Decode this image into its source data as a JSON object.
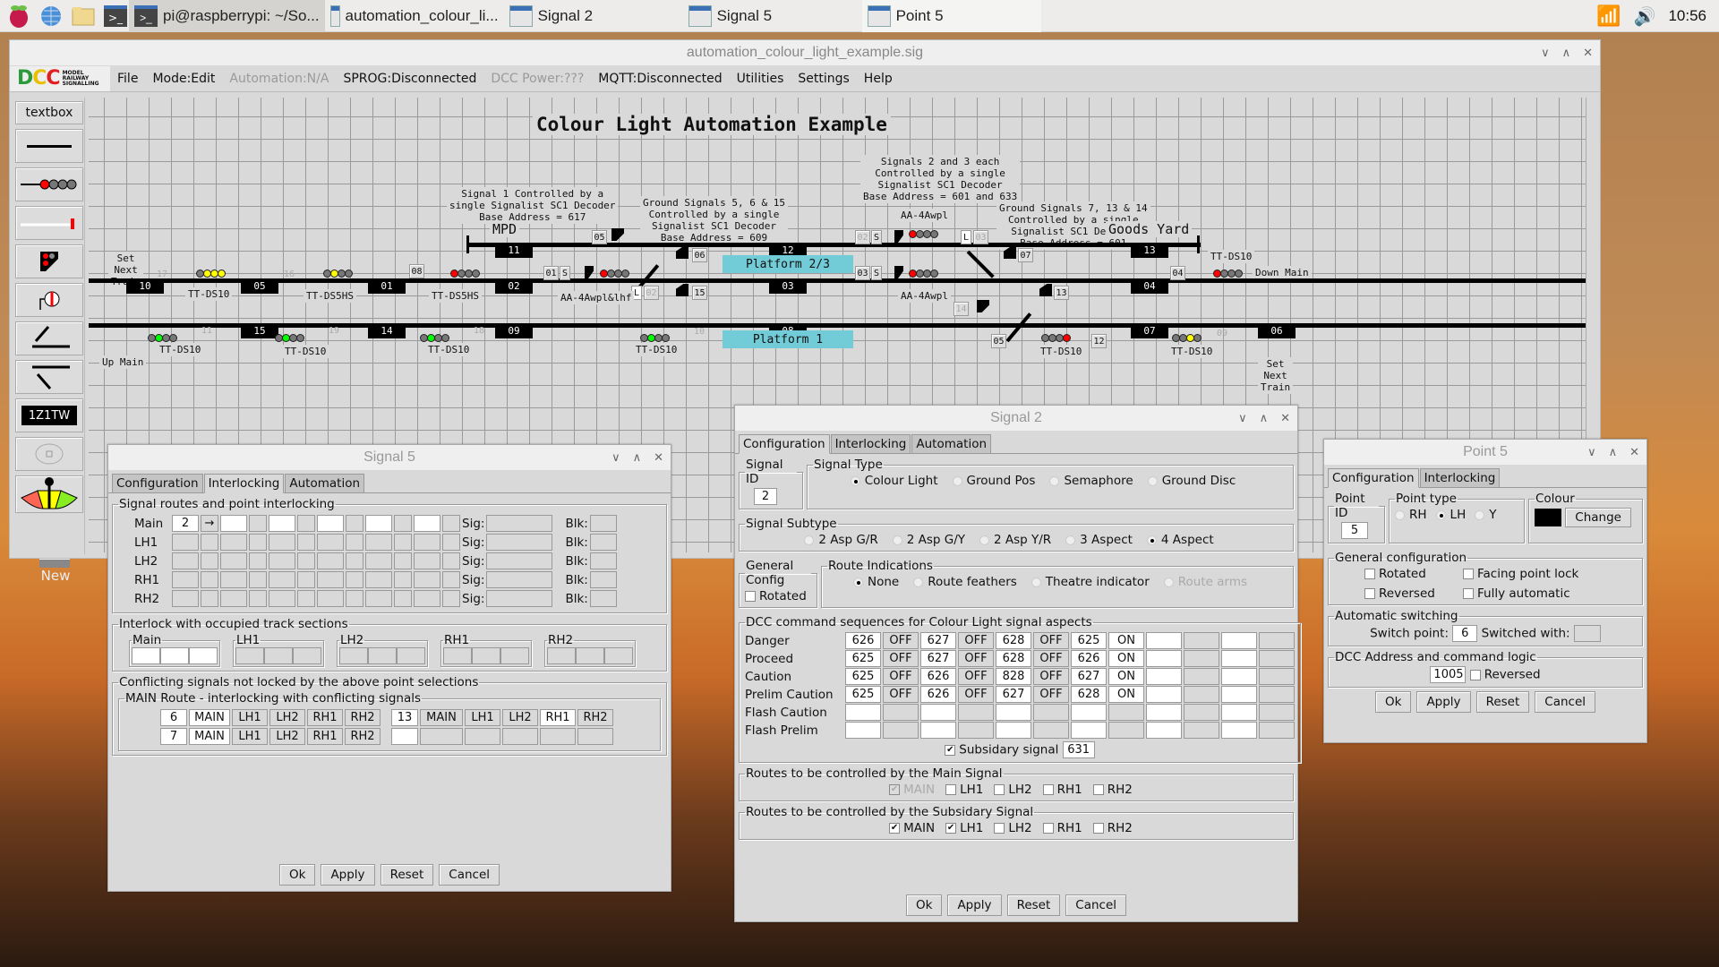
{
  "taskbar": {
    "tasks": [
      {
        "label": "pi@raspberrypi: ~/So..."
      },
      {
        "label": "automation_colour_li..."
      },
      {
        "label": "Signal 2"
      },
      {
        "label": "Signal 5"
      },
      {
        "label": "Point 5"
      }
    ],
    "clock": "10:56"
  },
  "desktop": {
    "new_icon_label": "New"
  },
  "main_window": {
    "title": "automation_colour_light_example.sig",
    "logo_text": "DCC",
    "logo_sub": "MODEL RAILWAY SIGNALLING",
    "menu": [
      {
        "label": "File",
        "enabled": true
      },
      {
        "label": "Mode:Edit",
        "enabled": true
      },
      {
        "label": "Automation:N/A",
        "enabled": false
      },
      {
        "label": "SPROG:Disconnected",
        "enabled": true
      },
      {
        "label": "DCC Power:???",
        "enabled": false
      },
      {
        "label": "MQTT:Disconnected",
        "enabled": true
      },
      {
        "label": "Utilities",
        "enabled": true
      },
      {
        "label": "Settings",
        "enabled": true
      },
      {
        "label": "Help",
        "enabled": true
      }
    ],
    "toolbox": {
      "textbox": "textbox",
      "train_label": "1Z1TW"
    }
  },
  "schematic": {
    "title": "Colour Light Automation Example",
    "mpd": "MPD",
    "goods_yard": "Goods Yard",
    "notes": {
      "sig1": "Signal 1 Controlled by a\nsingle Signalist SC1 Decoder\nBase Address = 617",
      "ground_5_6_15": "Ground Signals 5, 6 & 15\nControlled by a single\nSignalist SC1 Decoder\nBase Address = 609",
      "sig2_3": "Signals 2 and 3 each\nControlled by a single\nSignalist SC1 Decoder\nBase Address = 601 and 633",
      "ground_7_13_14": "Ground Signals 7, 13 & 14\nControlled by a single\nSignalist SC1 Decoder\nBase Address = 601",
      "set_next_left": "Set\nNext\nTrain",
      "set_next_right": "Set\nNext\nTrain",
      "up_main": "Up Main",
      "down_main": "Down Main"
    },
    "sections": {
      "s10": "10",
      "s05": "05",
      "s01": "01",
      "s02": "02",
      "s11": "11",
      "s12": "12",
      "s03": "03",
      "s13": "13",
      "s04": "04",
      "s15": "15",
      "s14": "14",
      "s09": "09",
      "s08": "08",
      "s07": "07",
      "s06": "06"
    },
    "platforms": {
      "p23": "Platform 2/3",
      "p1": "Platform 1"
    },
    "signal_labels": {
      "a": "TT-DS10",
      "b": "TT-DS5HS",
      "c": "TT-DS5HS",
      "d": "AA-4Awpl&lhf",
      "e": "AA-4Awpl",
      "f": "AA-4Awpl",
      "g": "TT-DS10",
      "h": "TT-DS10",
      "i": "TT-DS10",
      "j": "TT-DS10",
      "k": "TT-DS10",
      "l": "TT-DS10",
      "m": "TT-DS10"
    },
    "ids": {
      "i17": "17",
      "i16": "16",
      "i08": "08",
      "i11": "11",
      "i19": "19",
      "i18": "18",
      "i05": "05",
      "i06": "06",
      "i01": "01",
      "iS": "S",
      "iL": "L",
      "i02": "02",
      "i15": "15",
      "i10": "10",
      "i02b": "02",
      "i03": "03",
      "i03b": "03",
      "i07": "07",
      "i04": "04",
      "i13": "13",
      "i14": "14",
      "i05b": "05",
      "i12": "12",
      "i09": "09"
    }
  },
  "signal5": {
    "title": "Signal 5",
    "tabs": [
      "Configuration",
      "Interlocking",
      "Automation"
    ],
    "active_tab": "Interlocking",
    "routes_legend": "Signal routes and point interlocking",
    "routes": [
      {
        "name": "Main",
        "first_point": "2",
        "arrow": "→"
      },
      {
        "name": "LH1"
      },
      {
        "name": "LH2"
      },
      {
        "name": "RH1"
      },
      {
        "name": "RH2"
      }
    ],
    "sig_label": "Sig:",
    "blk_label": "Blk:",
    "occupied_legend": "Interlock with occupied track sections",
    "occupied_groups": [
      "Main",
      "LH1",
      "LH2",
      "RH1",
      "RH2"
    ],
    "conflict_legend": "Conflicting signals not locked by the above point selections",
    "main_route_legend": "MAIN Route - interlocking with conflicting signals",
    "conflicts": [
      {
        "sig": "6",
        "routes": [
          "MAIN",
          "LH1",
          "LH2",
          "RH1",
          "RH2"
        ],
        "sig2": "13",
        "routes2": [
          "MAIN",
          "LH1",
          "LH2",
          "RH1",
          "RH2"
        ]
      },
      {
        "sig": "7",
        "routes": [
          "MAIN",
          "LH1",
          "LH2",
          "RH1",
          "RH2"
        ],
        "sig2": "",
        "routes2": [
          "",
          "",
          "",
          "",
          ""
        ]
      }
    ],
    "buttons": {
      "ok": "Ok",
      "apply": "Apply",
      "reset": "Reset",
      "cancel": "Cancel"
    }
  },
  "signal2": {
    "title": "Signal 2",
    "tabs": [
      "Configuration",
      "Interlocking",
      "Automation"
    ],
    "active_tab": "Configuration",
    "signal_id_legend": "Signal ID",
    "signal_id": "2",
    "signal_type_legend": "Signal Type",
    "signal_types": [
      "Colour Light",
      "Ground Pos",
      "Semaphore",
      "Ground Disc"
    ],
    "signal_type_selected": "Colour Light",
    "subtype_legend": "Signal Subtype",
    "subtypes": [
      "2 Asp G/R",
      "2 Asp G/Y",
      "2 Asp Y/R",
      "3 Aspect",
      "4 Aspect"
    ],
    "subtype_selected": "4 Aspect",
    "general_legend": "General Config",
    "rotated_label": "Rotated",
    "route_ind_legend": "Route Indications",
    "route_inds": [
      "None",
      "Route feathers",
      "Theatre indicator",
      "Route arms"
    ],
    "route_ind_selected": "None",
    "dcc_legend": "DCC command sequences for Colour Light signal aspects",
    "dcc_rows": [
      {
        "aspect": "Danger",
        "cmds": [
          [
            "626",
            "OFF"
          ],
          [
            "627",
            "OFF"
          ],
          [
            "628",
            "OFF"
          ],
          [
            "625",
            "ON"
          ],
          [
            "",
            ""
          ],
          [
            "",
            ""
          ]
        ]
      },
      {
        "aspect": "Proceed",
        "cmds": [
          [
            "625",
            "OFF"
          ],
          [
            "627",
            "OFF"
          ],
          [
            "628",
            "OFF"
          ],
          [
            "626",
            "ON"
          ],
          [
            "",
            ""
          ],
          [
            "",
            ""
          ]
        ]
      },
      {
        "aspect": "Caution",
        "cmds": [
          [
            "625",
            "OFF"
          ],
          [
            "626",
            "OFF"
          ],
          [
            "828",
            "OFF"
          ],
          [
            "627",
            "ON"
          ],
          [
            "",
            ""
          ],
          [
            "",
            ""
          ]
        ]
      },
      {
        "aspect": "Prelim Caution",
        "cmds": [
          [
            "625",
            "OFF"
          ],
          [
            "626",
            "OFF"
          ],
          [
            "627",
            "OFF"
          ],
          [
            "628",
            "ON"
          ],
          [
            "",
            ""
          ],
          [
            "",
            ""
          ]
        ]
      },
      {
        "aspect": "Flash Caution",
        "cmds": [
          [
            "",
            ""
          ],
          [
            "",
            ""
          ],
          [
            "",
            ""
          ],
          [
            "",
            ""
          ],
          [
            "",
            ""
          ],
          [
            "",
            ""
          ]
        ]
      },
      {
        "aspect": "Flash Prelim",
        "cmds": [
          [
            "",
            ""
          ],
          [
            "",
            ""
          ],
          [
            "",
            ""
          ],
          [
            "",
            ""
          ],
          [
            "",
            ""
          ],
          [
            "",
            ""
          ]
        ]
      }
    ],
    "subsidary_label": "Subsidary signal",
    "subsidary_checked": true,
    "subsidary_address": "631",
    "main_routes_legend": "Routes to be controlled by the Main Signal",
    "main_routes": [
      {
        "label": "MAIN",
        "checked": true,
        "disabled": true
      },
      {
        "label": "LH1",
        "checked": false
      },
      {
        "label": "LH2",
        "checked": false
      },
      {
        "label": "RH1",
        "checked": false
      },
      {
        "label": "RH2",
        "checked": false
      }
    ],
    "sub_routes_legend": "Routes to be controlled by the Subsidary Signal",
    "sub_routes": [
      {
        "label": "MAIN",
        "checked": true
      },
      {
        "label": "LH1",
        "checked": true
      },
      {
        "label": "LH2",
        "checked": false
      },
      {
        "label": "RH1",
        "checked": false
      },
      {
        "label": "RH2",
        "checked": false
      }
    ],
    "buttons": {
      "ok": "Ok",
      "apply": "Apply",
      "reset": "Reset",
      "cancel": "Cancel"
    }
  },
  "point5": {
    "title": "Point 5",
    "tabs": [
      "Configuration",
      "Interlocking"
    ],
    "active_tab": "Configuration",
    "point_id_legend": "Point ID",
    "point_id": "5",
    "point_type_legend": "Point type",
    "point_types": [
      "RH",
      "LH",
      "Y"
    ],
    "point_type_selected": "LH",
    "colour_legend": "Colour",
    "colour_value": "#000000",
    "change_label": "Change",
    "general_legend": "General configuration",
    "rotated": "Rotated",
    "facing_point_lock": "Facing point lock",
    "reversed": "Reversed",
    "fully_automatic": "Fully automatic",
    "auto_legend": "Automatic switching",
    "switch_point_label": "Switch point:",
    "switch_point_value": "6",
    "switched_with_label": "Switched with:",
    "switched_with_value": "",
    "dcc_legend": "DCC Address and command logic",
    "dcc_address": "1005",
    "dcc_reversed": "Reversed",
    "buttons": {
      "ok": "Ok",
      "apply": "Apply",
      "reset": "Reset",
      "cancel": "Cancel"
    }
  }
}
